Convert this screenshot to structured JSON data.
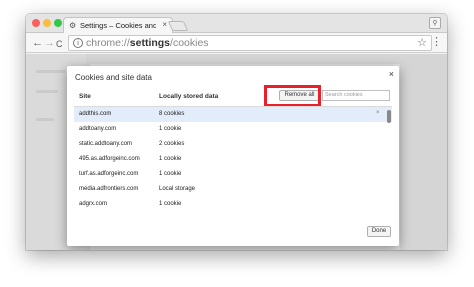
{
  "window": {
    "traffic_lights": {
      "close": "#fc605b",
      "minimize": "#fdbc40",
      "zoom": "#34c84a"
    }
  },
  "tab": {
    "title": "Settings – Cookies and site d",
    "favicon": "gear-icon",
    "close_glyph": "×"
  },
  "toolbar": {
    "back_glyph": "←",
    "forward_glyph": "→",
    "reload_glyph": "C",
    "url_scheme": "chrome://",
    "url_host": "settings",
    "url_path": "/cookies",
    "star_glyph": "☆",
    "menu_glyph": "⋮"
  },
  "dialog": {
    "title": "Cookies and site data",
    "close_glyph": "×",
    "columns": {
      "site": "Site",
      "local": "Locally stored data"
    },
    "remove_all_label": "Remove all",
    "search_placeholder": "Search cookies",
    "rows": [
      {
        "site": "addthis.com",
        "local": "8 cookies"
      },
      {
        "site": "addtoany.com",
        "local": "1 cookie"
      },
      {
        "site": "static.addtoany.com",
        "local": "2 cookies"
      },
      {
        "site": "495.as.adforgeinc.com",
        "local": "1 cookie"
      },
      {
        "site": "turf.as.adforgeinc.com",
        "local": "1 cookie"
      },
      {
        "site": "media.adfrontiers.com",
        "local": "Local storage"
      },
      {
        "site": "adgrx.com",
        "local": "1 cookie"
      }
    ],
    "row_close_glyph": "×",
    "done_label": "Done",
    "highlight_color": "#e8202a",
    "selected_row_color": "#e3ecfa"
  }
}
